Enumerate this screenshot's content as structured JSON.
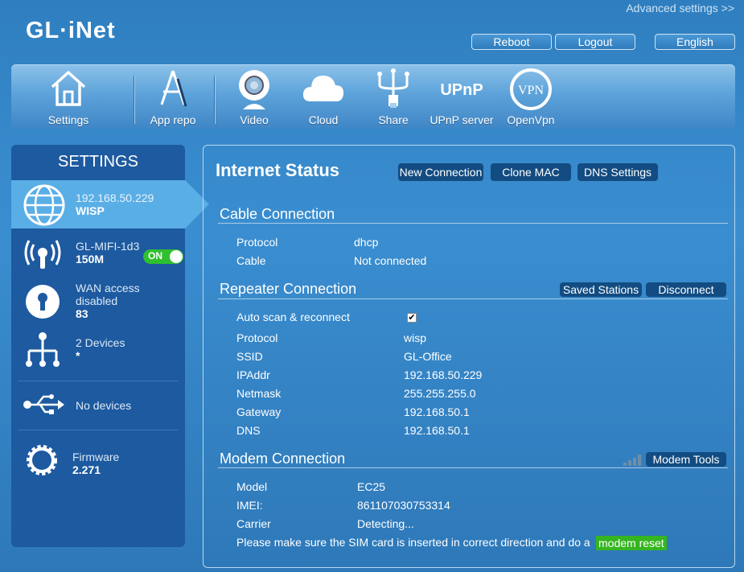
{
  "header": {
    "logo": "GL·iNet",
    "advanced_link": "Advanced settings >>",
    "reboot": "Reboot",
    "logout": "Logout",
    "language": "English"
  },
  "toolbar": [
    {
      "label": "Settings",
      "icon": "home-icon"
    },
    {
      "label": "App repo",
      "icon": "app-repo-icon"
    },
    {
      "label": "Video",
      "icon": "webcam-icon"
    },
    {
      "label": "Cloud",
      "icon": "cloud-icon"
    },
    {
      "label": "Share",
      "icon": "usb-share-icon"
    },
    {
      "label": "UPnP server",
      "icon": "upnp-icon"
    },
    {
      "label": "OpenVpn",
      "icon": "vpn-icon"
    }
  ],
  "toolbar_icon_text": {
    "upnp": "UPnP",
    "vpn": "VPN"
  },
  "sidebar": {
    "title": "SETTINGS",
    "wisp": {
      "ip": "192.168.50.229",
      "mode": "WISP"
    },
    "wifi": {
      "ssid": "GL-MIFI-1d3",
      "speed": "150M",
      "toggle": "ON"
    },
    "wan": {
      "line1": "WAN access",
      "line2": "disabled",
      "value": "83"
    },
    "devices": {
      "label": "2 Devices",
      "value": "*"
    },
    "usb": {
      "label": "No devices"
    },
    "firmware": {
      "label": "Firmware",
      "version": "2.271"
    }
  },
  "main": {
    "title": "Internet Status",
    "buttons": {
      "new_connection": "New Connection",
      "clone_mac": "Clone MAC",
      "dns_settings": "DNS Settings"
    },
    "cable": {
      "heading": "Cable Connection",
      "rows": [
        {
          "label": "Protocol",
          "value": "dhcp"
        },
        {
          "label": "Cable",
          "value": "Not connected"
        }
      ]
    },
    "repeater": {
      "heading": "Repeater Connection",
      "saved_stations": "Saved Stations",
      "disconnect": "Disconnect",
      "auto_scan": "Auto scan & reconnect",
      "auto_scan_checked": true,
      "check_mark": "✔",
      "rows": [
        {
          "label": "Protocol",
          "value": "wisp"
        },
        {
          "label": "SSID",
          "value": "GL-Office"
        },
        {
          "label": "IPAddr",
          "value": "192.168.50.229"
        },
        {
          "label": "Netmask",
          "value": "255.255.255.0"
        },
        {
          "label": "Gateway",
          "value": "192.168.50.1"
        },
        {
          "label": "DNS",
          "value": "192.168.50.1"
        }
      ]
    },
    "modem": {
      "heading": "Modem Connection",
      "tools": "Modem Tools",
      "rows": [
        {
          "label": "Model",
          "value": "EC25"
        },
        {
          "label": "IMEI:",
          "value": "861107030753314"
        },
        {
          "label": "Carrier",
          "value": "Detecting..."
        }
      ],
      "notice": "Please make sure the SIM card is inserted in correct direction and do a",
      "reset_link": "modem reset"
    }
  },
  "colors": {
    "toggle_on": "#2fc02f",
    "modem_reset": "#35b51f",
    "button_dark": "#124c82"
  }
}
